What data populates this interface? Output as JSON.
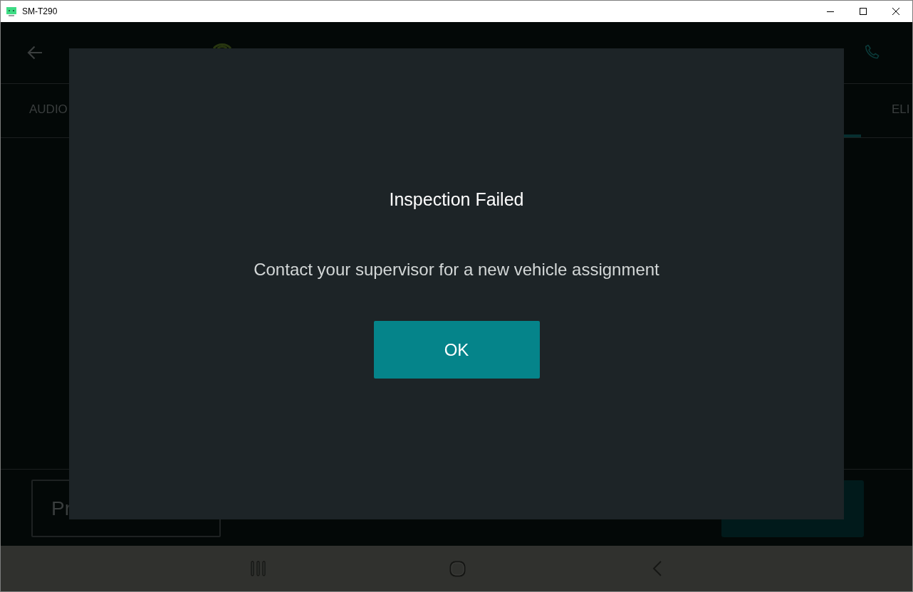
{
  "window": {
    "title": "SM-T290"
  },
  "tabs": [
    {
      "label": "AUDIO",
      "selected": false
    },
    {
      "selected": true
    },
    {
      "label": "ELI",
      "selected": false
    }
  ],
  "bottom_bar": {
    "buttons": [
      {
        "kind": "outlined",
        "label": "Pr"
      },
      {
        "kind": "filled"
      }
    ]
  },
  "dialog": {
    "title": "Inspection Failed",
    "message": "Contact your supervisor for a new vehicle assignment",
    "button": "OK"
  }
}
